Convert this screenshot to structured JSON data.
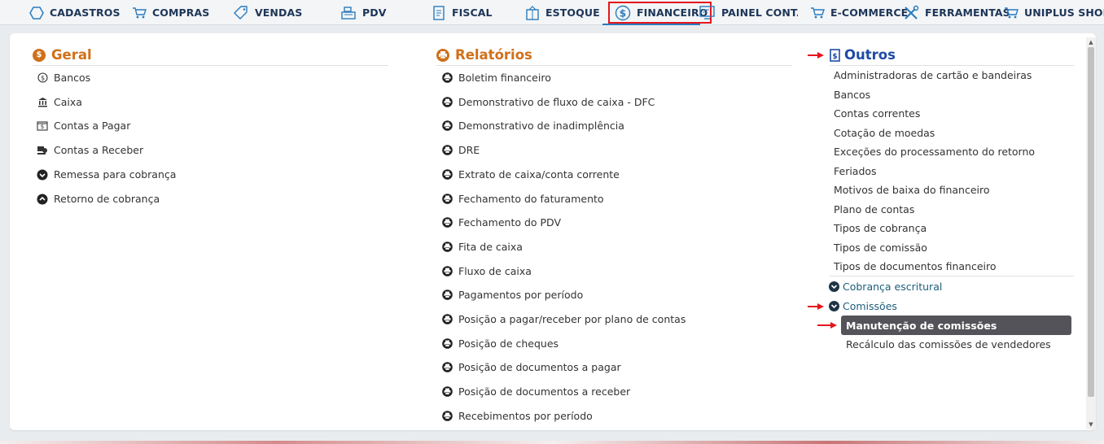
{
  "nav": [
    {
      "label": "CADASTROS",
      "icon": "hexagon-icon"
    },
    {
      "label": "COMPRAS",
      "icon": "cart-icon"
    },
    {
      "label": "VENDAS",
      "icon": "tag-icon"
    },
    {
      "label": "PDV",
      "icon": "cash-register-icon"
    },
    {
      "label": "FISCAL",
      "icon": "receipt-icon"
    },
    {
      "label": "ESTOQUE",
      "icon": "box-icon"
    },
    {
      "label": "FINANCEIRO",
      "icon": "dollar-circle-icon"
    },
    {
      "label": "PAINEL CONTADOR",
      "icon": "monitor-icon"
    },
    {
      "label": "E-COMMERCE",
      "icon": "cart-icon"
    },
    {
      "label": "FERRAMENTAS",
      "icon": "tools-icon"
    },
    {
      "label": "UNIPLUS SHOP",
      "icon": "cart-icon"
    }
  ],
  "active_nav": "FINANCEIRO",
  "colors": {
    "accent_orange": "#d0701a",
    "accent_blue": "#1f4aa5",
    "highlight_red": "#e3161c",
    "selected_bg": "#55535a"
  },
  "geral": {
    "title": "Geral",
    "items": [
      {
        "label": "Bancos",
        "icon": "dollar-circle-icon"
      },
      {
        "label": "Caixa",
        "icon": "bank-icon"
      },
      {
        "label": "Contas a Pagar",
        "icon": "bill-icon"
      },
      {
        "label": "Contas a Receber",
        "icon": "money-hand-icon"
      },
      {
        "label": "Remessa para cobrança",
        "icon": "chevron-down-circle-icon"
      },
      {
        "label": "Retorno de cobrança",
        "icon": "chevron-up-circle-icon"
      }
    ]
  },
  "relatorios": {
    "title": "Relatórios",
    "items": [
      "Boletim financeiro",
      "Demonstrativo de fluxo de caixa - DFC",
      "Demonstrativo de inadimplência",
      "DRE",
      "Extrato de caixa/conta corrente",
      "Fechamento do faturamento",
      "Fechamento do PDV",
      "Fita de caixa",
      "Fluxo de caixa",
      "Pagamentos por período",
      "Posição a pagar/receber por plano de contas",
      "Posição de cheques",
      "Posição de documentos a pagar",
      "Posição de documentos a receber",
      "Recebimentos por período"
    ]
  },
  "outros": {
    "title": "Outros",
    "items": [
      "Administradoras de cartão e bandeiras",
      "Bancos",
      "Contas correntes",
      "Cotação de moedas",
      "Exceções do processamento do retorno",
      "Feriados",
      "Motivos de baixa do financeiro",
      "Plano de contas",
      "Tipos de cobrança",
      "Tipos de comissão",
      "Tipos de documentos financeiro"
    ],
    "groups": [
      {
        "label": "Cobrança escritural",
        "expanded": false
      },
      {
        "label": "Comissões",
        "expanded": true,
        "children": [
          "Manutenção de comissões",
          "Recálculo das comissões de vendedores"
        ]
      }
    ],
    "selected_item": "Manutenção de comissões"
  }
}
